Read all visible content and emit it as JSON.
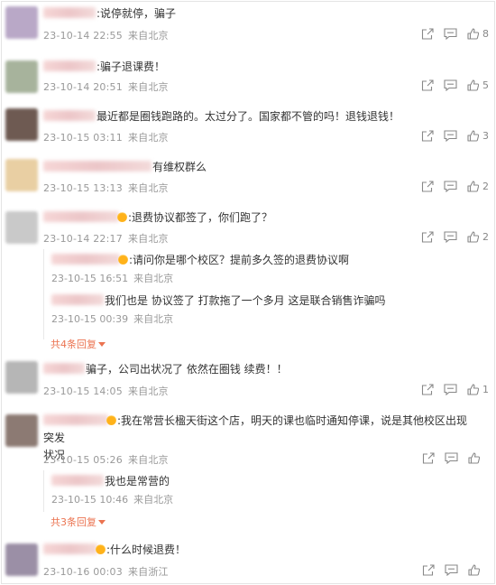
{
  "comments": [
    {
      "text": ":说停就停，骗子",
      "time": "23-10-14 22:55",
      "source": "来自北京",
      "likes": "8",
      "avatar_color": "#b9a8c7"
    },
    {
      "text": ":骗子退课费！",
      "time": "23-10-14 20:51",
      "source": "来自北京",
      "likes": "5",
      "avatar_color": "#a7b39c"
    },
    {
      "text": "最近都是圈钱跑路的。太过分了。国家都不管的吗！退钱退钱！",
      "time": "23-10-15 03:11",
      "source": "来自北京",
      "likes": "3",
      "avatar_color": "#6e5a52"
    },
    {
      "text": "有维权群么",
      "time": "23-10-15 13:13",
      "source": "来自北京",
      "likes": "2",
      "avatar_color": "#e9cfa3"
    },
    {
      "text": ":退费协议都签了，你们跑了？",
      "time": "23-10-14 22:17",
      "source": "来自北京",
      "likes": "2",
      "avatar_color": "#c9c9c9",
      "replies": [
        {
          "text": ":请问你是哪个校区？提前多久签的退费协议啊",
          "time": "23-10-15 16:51",
          "source": "来自北京"
        },
        {
          "text": "我们也是 协议签了 打款拖了一个多月 这是联合销售诈骗吗",
          "time": "23-10-15 00:39",
          "source": "来自北京"
        }
      ],
      "more": "共4条回复"
    },
    {
      "text": "骗子，公司出状况了 依然在圈钱 续费！！",
      "time": "23-10-15 14:05",
      "source": "来自北京",
      "likes": "1",
      "avatar_color": "#b6b6b6"
    },
    {
      "text": ":我在常营长楹天街这个店，明天的课也临时通知停课，说是其他校区出现突发",
      "text2": "状况",
      "time": "23-10-15 05:26",
      "source": "来自北京",
      "likes": "",
      "avatar_color": "#8c7a73",
      "replies": [
        {
          "text": "我也是常营的",
          "time": "23-10-15 10:46",
          "source": "来自北京"
        }
      ],
      "more": "共3条回复"
    },
    {
      "text": ":什么时候退费！",
      "time": "23-10-16 00:03",
      "source": "来自浙江",
      "likes": "",
      "avatar_color": "#9b8fa6"
    }
  ],
  "icons": {
    "share": "share-icon",
    "comment": "comment-icon",
    "like": "thumbs-up-icon"
  }
}
